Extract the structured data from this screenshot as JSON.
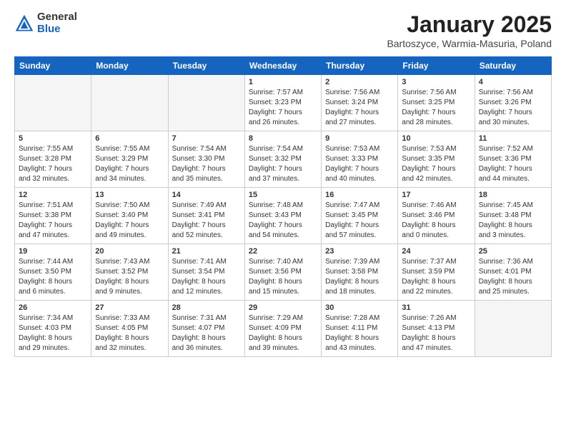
{
  "logo": {
    "general": "General",
    "blue": "Blue"
  },
  "header": {
    "title": "January 2025",
    "subtitle": "Bartoszyce, Warmia-Masuria, Poland"
  },
  "weekdays": [
    "Sunday",
    "Monday",
    "Tuesday",
    "Wednesday",
    "Thursday",
    "Friday",
    "Saturday"
  ],
  "weeks": [
    [
      {
        "day": "",
        "info": ""
      },
      {
        "day": "",
        "info": ""
      },
      {
        "day": "",
        "info": ""
      },
      {
        "day": "1",
        "info": "Sunrise: 7:57 AM\nSunset: 3:23 PM\nDaylight: 7 hours\nand 26 minutes."
      },
      {
        "day": "2",
        "info": "Sunrise: 7:56 AM\nSunset: 3:24 PM\nDaylight: 7 hours\nand 27 minutes."
      },
      {
        "day": "3",
        "info": "Sunrise: 7:56 AM\nSunset: 3:25 PM\nDaylight: 7 hours\nand 28 minutes."
      },
      {
        "day": "4",
        "info": "Sunrise: 7:56 AM\nSunset: 3:26 PM\nDaylight: 7 hours\nand 30 minutes."
      }
    ],
    [
      {
        "day": "5",
        "info": "Sunrise: 7:55 AM\nSunset: 3:28 PM\nDaylight: 7 hours\nand 32 minutes."
      },
      {
        "day": "6",
        "info": "Sunrise: 7:55 AM\nSunset: 3:29 PM\nDaylight: 7 hours\nand 34 minutes."
      },
      {
        "day": "7",
        "info": "Sunrise: 7:54 AM\nSunset: 3:30 PM\nDaylight: 7 hours\nand 35 minutes."
      },
      {
        "day": "8",
        "info": "Sunrise: 7:54 AM\nSunset: 3:32 PM\nDaylight: 7 hours\nand 37 minutes."
      },
      {
        "day": "9",
        "info": "Sunrise: 7:53 AM\nSunset: 3:33 PM\nDaylight: 7 hours\nand 40 minutes."
      },
      {
        "day": "10",
        "info": "Sunrise: 7:53 AM\nSunset: 3:35 PM\nDaylight: 7 hours\nand 42 minutes."
      },
      {
        "day": "11",
        "info": "Sunrise: 7:52 AM\nSunset: 3:36 PM\nDaylight: 7 hours\nand 44 minutes."
      }
    ],
    [
      {
        "day": "12",
        "info": "Sunrise: 7:51 AM\nSunset: 3:38 PM\nDaylight: 7 hours\nand 47 minutes."
      },
      {
        "day": "13",
        "info": "Sunrise: 7:50 AM\nSunset: 3:40 PM\nDaylight: 7 hours\nand 49 minutes."
      },
      {
        "day": "14",
        "info": "Sunrise: 7:49 AM\nSunset: 3:41 PM\nDaylight: 7 hours\nand 52 minutes."
      },
      {
        "day": "15",
        "info": "Sunrise: 7:48 AM\nSunset: 3:43 PM\nDaylight: 7 hours\nand 54 minutes."
      },
      {
        "day": "16",
        "info": "Sunrise: 7:47 AM\nSunset: 3:45 PM\nDaylight: 7 hours\nand 57 minutes."
      },
      {
        "day": "17",
        "info": "Sunrise: 7:46 AM\nSunset: 3:46 PM\nDaylight: 8 hours\nand 0 minutes."
      },
      {
        "day": "18",
        "info": "Sunrise: 7:45 AM\nSunset: 3:48 PM\nDaylight: 8 hours\nand 3 minutes."
      }
    ],
    [
      {
        "day": "19",
        "info": "Sunrise: 7:44 AM\nSunset: 3:50 PM\nDaylight: 8 hours\nand 6 minutes."
      },
      {
        "day": "20",
        "info": "Sunrise: 7:43 AM\nSunset: 3:52 PM\nDaylight: 8 hours\nand 9 minutes."
      },
      {
        "day": "21",
        "info": "Sunrise: 7:41 AM\nSunset: 3:54 PM\nDaylight: 8 hours\nand 12 minutes."
      },
      {
        "day": "22",
        "info": "Sunrise: 7:40 AM\nSunset: 3:56 PM\nDaylight: 8 hours\nand 15 minutes."
      },
      {
        "day": "23",
        "info": "Sunrise: 7:39 AM\nSunset: 3:58 PM\nDaylight: 8 hours\nand 18 minutes."
      },
      {
        "day": "24",
        "info": "Sunrise: 7:37 AM\nSunset: 3:59 PM\nDaylight: 8 hours\nand 22 minutes."
      },
      {
        "day": "25",
        "info": "Sunrise: 7:36 AM\nSunset: 4:01 PM\nDaylight: 8 hours\nand 25 minutes."
      }
    ],
    [
      {
        "day": "26",
        "info": "Sunrise: 7:34 AM\nSunset: 4:03 PM\nDaylight: 8 hours\nand 29 minutes."
      },
      {
        "day": "27",
        "info": "Sunrise: 7:33 AM\nSunset: 4:05 PM\nDaylight: 8 hours\nand 32 minutes."
      },
      {
        "day": "28",
        "info": "Sunrise: 7:31 AM\nSunset: 4:07 PM\nDaylight: 8 hours\nand 36 minutes."
      },
      {
        "day": "29",
        "info": "Sunrise: 7:29 AM\nSunset: 4:09 PM\nDaylight: 8 hours\nand 39 minutes."
      },
      {
        "day": "30",
        "info": "Sunrise: 7:28 AM\nSunset: 4:11 PM\nDaylight: 8 hours\nand 43 minutes."
      },
      {
        "day": "31",
        "info": "Sunrise: 7:26 AM\nSunset: 4:13 PM\nDaylight: 8 hours\nand 47 minutes."
      },
      {
        "day": "",
        "info": ""
      }
    ]
  ]
}
